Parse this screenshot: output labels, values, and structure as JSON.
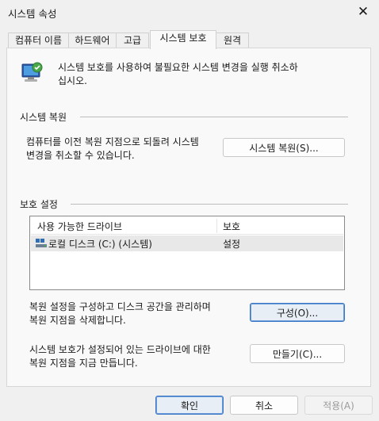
{
  "window": {
    "title": "시스템 속성",
    "close_glyph": "✕"
  },
  "tabs": [
    {
      "label": "컴퓨터 이름"
    },
    {
      "label": "하드웨어"
    },
    {
      "label": "고급"
    },
    {
      "label": "시스템 보호",
      "active": true
    },
    {
      "label": "원격"
    }
  ],
  "intro": {
    "icon": "system-protection-icon",
    "text_line1": "시스템 보호를 사용하여 불필요한 시스템 변경을 실행 취소하",
    "text_line2": "십시오."
  },
  "restore_group": {
    "title": "시스템 복원",
    "desc_line1": "컴퓨터를 이전 복원 지점으로 되돌려 시스템",
    "desc_line2": "변경을 취소할 수 있습니다.",
    "button_label": "시스템 복원(S)..."
  },
  "protection_group": {
    "title": "보호 설정",
    "columns": [
      "사용 가능한 드라이브",
      "보호"
    ],
    "drives": [
      {
        "name": "로컬 디스크 (C:) (시스템)",
        "protection": "설정",
        "icon": "drive-icon"
      }
    ],
    "configure_desc_line1": "복원 설정을 구성하고 디스크 공간을 관리하며",
    "configure_desc_line2": "복원 지점을 삭제합니다.",
    "configure_label": "구성(O)...",
    "create_desc_line1": "시스템 보호가 설정되어 있는 드라이브에 대한",
    "create_desc_line2": "복원 지점을 지금 만듭니다.",
    "create_label": "만들기(C)..."
  },
  "footer": {
    "ok_label": "확인",
    "cancel_label": "취소",
    "apply_label": "적용(A)"
  },
  "colors": {
    "accent": "#3b78c6",
    "window_bg": "#f0f0f0",
    "panel_bg": "#f9f9f9"
  }
}
